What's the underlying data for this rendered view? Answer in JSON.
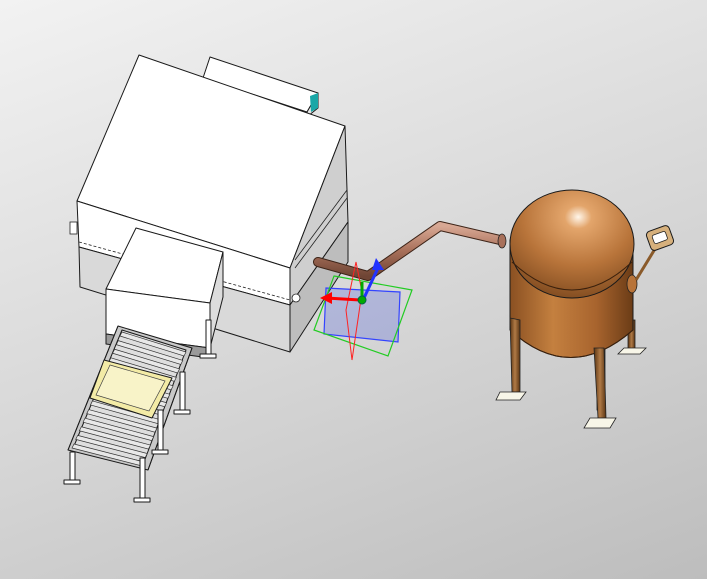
{
  "viewport": {
    "description_free": true,
    "background_top": "#f2f2f2",
    "background_bottom": "#bdbdbd"
  },
  "colors": {
    "machine_body": "#ffffff",
    "machine_shadow": "#d9d9d9",
    "tank": "#b8743a",
    "tank_highlight": "#fff2e0",
    "pipe": "#a8705a",
    "tray": "#f3eba6",
    "triad_x": "#ff0000",
    "triad_y": "#00aa00",
    "triad_z": "#2233ff",
    "plane_green": "#22cc22",
    "plane_blue": "#3344ff",
    "accent_teal": "#1aa7a7"
  },
  "icons": {
    "triad": "coordinate-triad-icon",
    "gauge": "pressure-gauge-icon"
  }
}
